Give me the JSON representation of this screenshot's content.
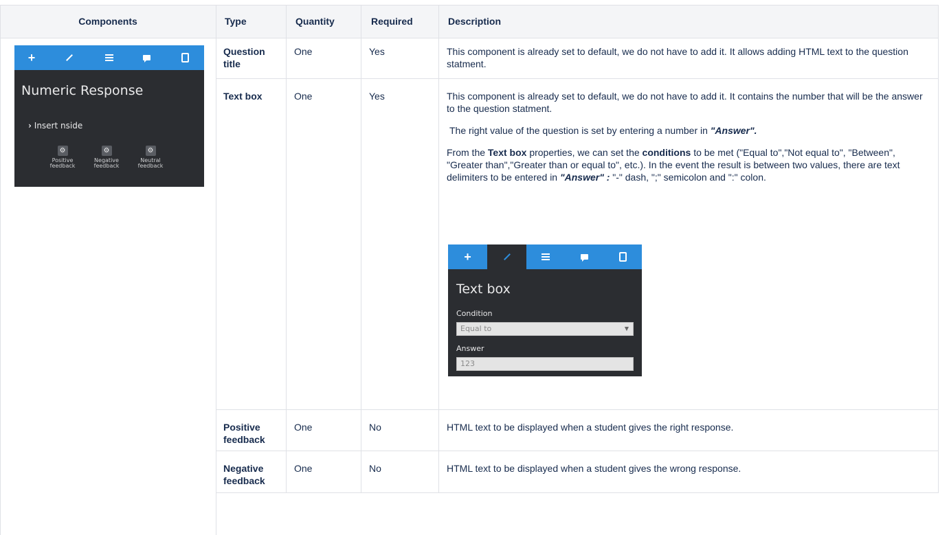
{
  "headers": {
    "components": "Components",
    "type": "Type",
    "quantity": "Quantity",
    "required": "Required",
    "description": "Description"
  },
  "component_panel": {
    "title": "Numeric Response",
    "insert_label": "Insert nside",
    "tabs": [
      "add-icon",
      "pencil-icon",
      "list-icon",
      "chat-icon",
      "mobile-icon"
    ],
    "components": [
      {
        "line1": "Positive",
        "line2": "feedback"
      },
      {
        "line1": "Negative",
        "line2": "feedback"
      },
      {
        "line1": "Neutral",
        "line2": "feedback"
      }
    ]
  },
  "rows": [
    {
      "type": "Question title",
      "quantity": "One",
      "required": "Yes",
      "description": "This component is already set to default, we do not have to add it. It allows adding HTML text to the question statment."
    },
    {
      "type": "Text box",
      "quantity": "One",
      "required": "Yes",
      "description_p1": "This component is already set to default, we do not have to add it. It contains the number that will be the answer to the question statment.",
      "description_p2_pre": "The right value of the question is set by entering a number in ",
      "description_p2_em": "\"Answer\".",
      "description_p3_a": "From the ",
      "description_p3_b": "Text box",
      "description_p3_c": " properties, we can set the ",
      "description_p3_d": "conditions",
      "description_p3_e": " to be met (\"Equal to\",\"Not equal to\", \"Between\", \"Greater than\",\"Greater than or equal to\", etc.). In the event the result is between two values, there are text delimiters to be entered in ",
      "description_p3_f": "\"Answer\" :",
      "description_p3_g": " \"-\" dash, \";\" semicolon and \":\" colon.",
      "props_panel": {
        "title": "Text box",
        "condition_label": "Condition",
        "condition_value": "Equal to",
        "answer_label": "Answer",
        "answer_value": "123"
      }
    },
    {
      "type": "Positive feedback",
      "quantity": "One",
      "required": "No",
      "description": "HTML text to be displayed when a student gives the right response."
    },
    {
      "type": "Negative feedback",
      "quantity": "One",
      "required": "No",
      "description": "HTML text to be displayed when a student gives the wrong response."
    }
  ],
  "colors": {
    "tabbar": "#2d8ddc",
    "panel": "#2b2d31",
    "header_bg": "#f4f5f7",
    "border": "#dfe1e6"
  }
}
